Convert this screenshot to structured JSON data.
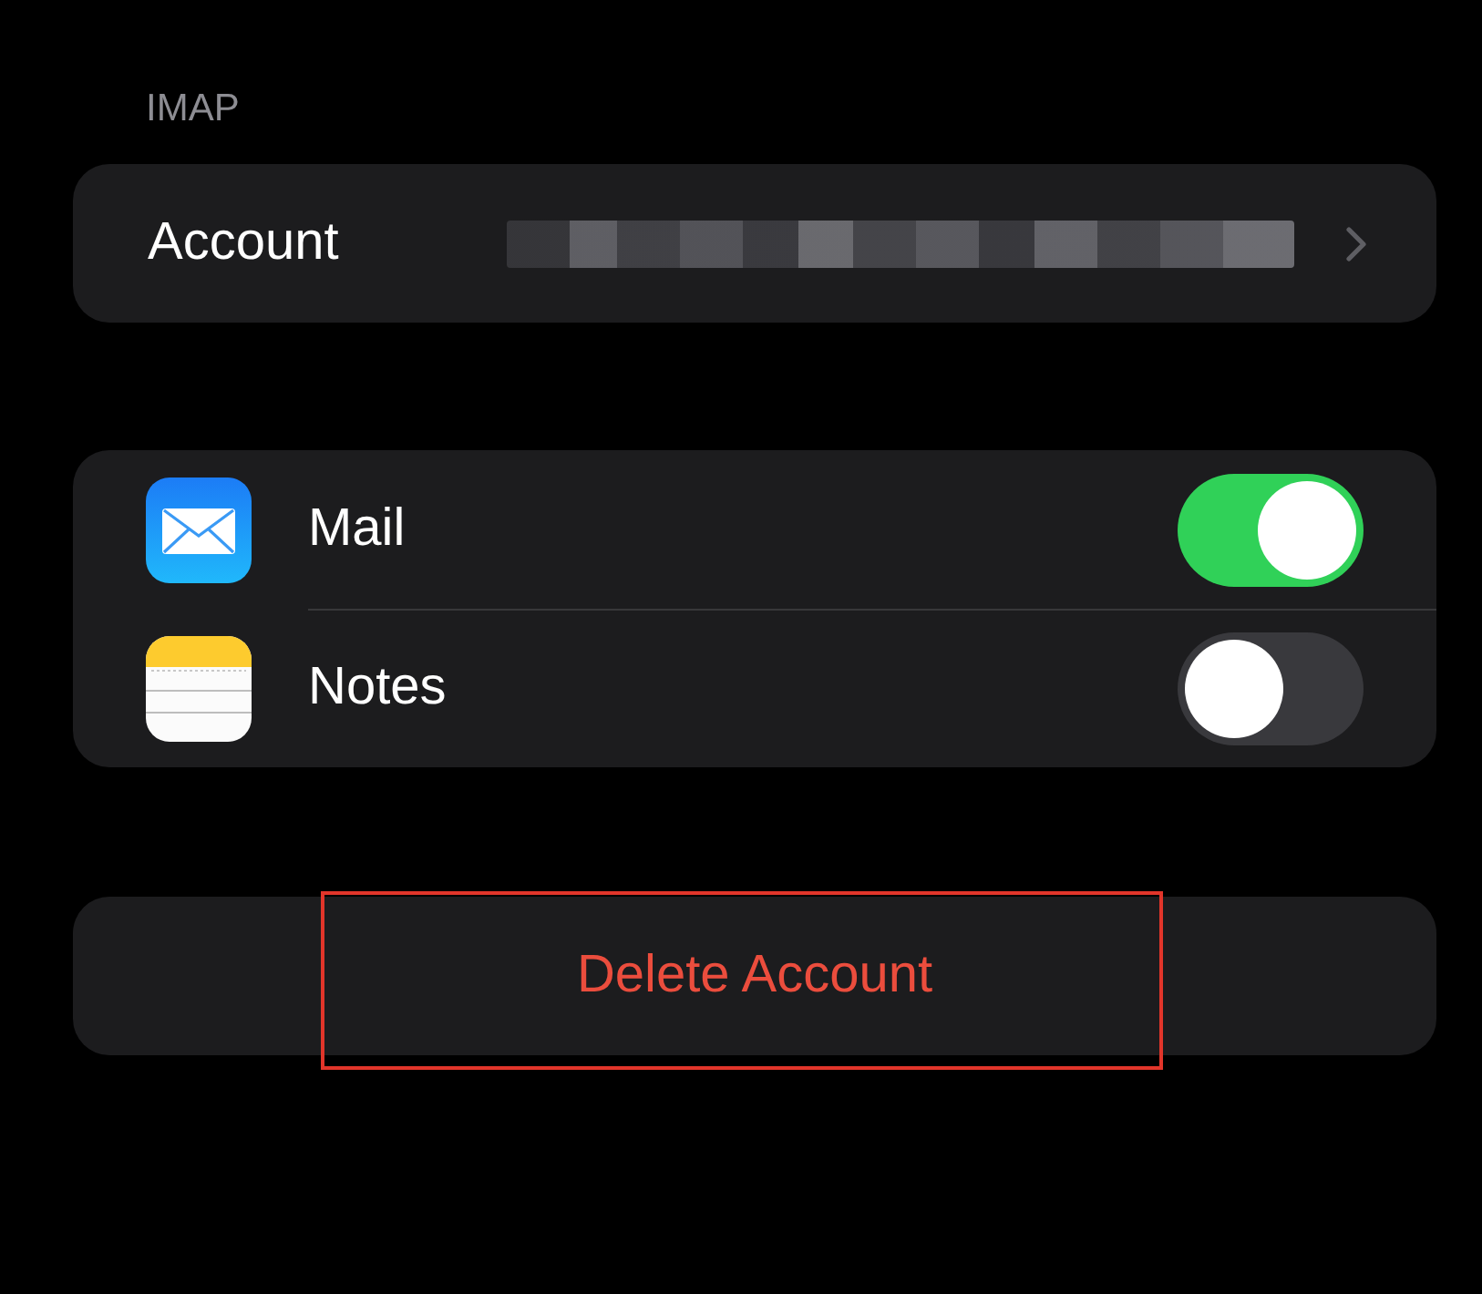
{
  "section_header": "IMAP",
  "account_row": {
    "label": "Account",
    "value_redacted": true
  },
  "toggles": [
    {
      "kind": "mail",
      "label": "Mail",
      "on": true
    },
    {
      "kind": "notes",
      "label": "Notes",
      "on": false
    }
  ],
  "delete_button": {
    "label": "Delete Account",
    "highlighted": true
  }
}
